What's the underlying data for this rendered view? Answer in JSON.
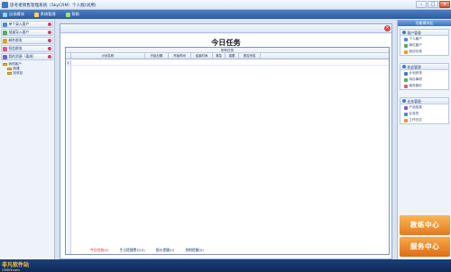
{
  "window": {
    "title": "思考者销售管理系统（SkyCRM）个人版(试用)",
    "minimize": "–",
    "maximize": "□",
    "close": "×"
  },
  "toolbar": [
    {
      "label": "自选模块",
      "icon": "module-icon",
      "color": "#8fd3ff"
    },
    {
      "label": "系统管理",
      "icon": "settings-icon",
      "color": "#ffd36b"
    },
    {
      "label": "帮助",
      "icon": "help-icon",
      "color": "#9be28a"
    }
  ],
  "sidebar": {
    "items": [
      {
        "label": "单个录入客户",
        "color": "#4a8ad8"
      },
      {
        "label": "批量导入客户",
        "color": "#4fae5c"
      },
      {
        "label": "邮件群发",
        "color": "#e69a2e"
      },
      {
        "label": "短信群发",
        "color": "#d65b8c"
      },
      {
        "label": "我的资源（离线）",
        "color": "#7a5ec8"
      }
    ],
    "tree": [
      {
        "label": "我的客户",
        "level": 0
      },
      {
        "label": "新建",
        "level": 1
      },
      {
        "label": "回收站",
        "level": 1
      }
    ]
  },
  "main": {
    "title": "今日任务",
    "grid_caption": "所有日历",
    "columns": [
      "计划名称",
      "开始日期",
      "开始时间",
      "结束时间",
      "紧急",
      "重要",
      "是否完成"
    ],
    "rows": [
      {
        "num": "1"
      }
    ],
    "links": [
      "今日任务(0)",
      "生日提醒累计(0)",
      "报价提醒(0)",
      "到期提醒(0)"
    ]
  },
  "right_panel": {
    "header": "功能模块区",
    "sections": [
      {
        "title": "客户管理",
        "items": [
          "个人客户",
          "单位客户",
          "回访记录"
        ]
      },
      {
        "title": "机会管理",
        "items": [
          "计划安排",
          "待办事项",
          "商务报价"
        ]
      },
      {
        "title": "业务管理",
        "items": [
          "产品信息",
          "业务员",
          "工作日志"
        ]
      }
    ],
    "train_button": "教练中心",
    "service_button": "服务中心"
  },
  "status": {
    "logo_title": "非凡软件站",
    "logo_sub": "CRSKY.com",
    "items": [
      "",
      "",
      "",
      ""
    ]
  }
}
